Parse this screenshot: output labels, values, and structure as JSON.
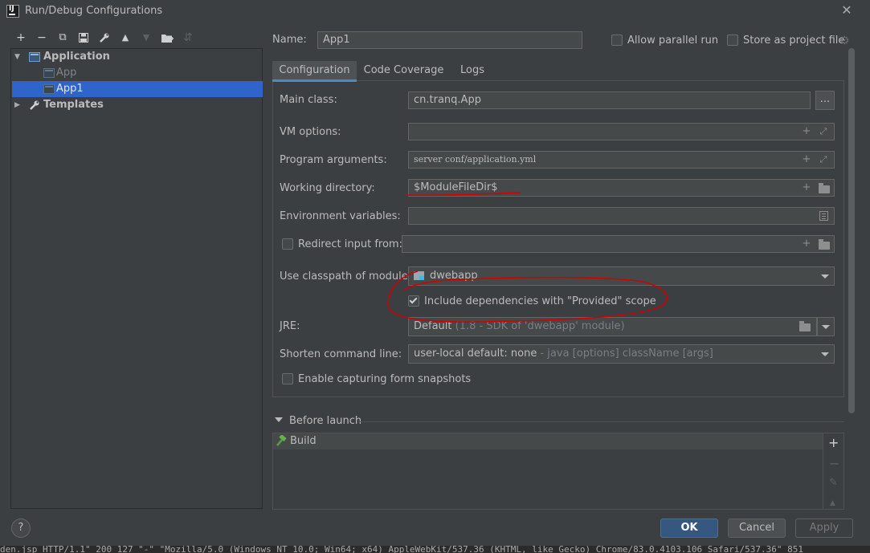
{
  "window": {
    "title": "Run/Debug Configurations",
    "logo_text": "IJ"
  },
  "toolbar": {
    "add": "+",
    "remove": "−",
    "copy": "⧉",
    "save": "▪",
    "edit": "🔧",
    "up": "▲",
    "down": "▼",
    "folder": "▇",
    "sort": "⇵"
  },
  "tree": {
    "application": "Application",
    "app": "App",
    "app1": "App1",
    "templates": "Templates"
  },
  "header": {
    "name_label": "Name:",
    "name_value": "App1",
    "allow_parallel": "Allow parallel run",
    "store_project": "Store as project file"
  },
  "tabs": [
    "Configuration",
    "Code Coverage",
    "Logs"
  ],
  "form": {
    "main_class_label": "Main class:",
    "main_class_value": "cn.tranq.App",
    "browse_label": "...",
    "vm_options_label": "VM options:",
    "vm_options_value": "",
    "program_args_label": "Program arguments:",
    "program_args_value": "server conf/application.yml",
    "working_dir_label": "Working directory:",
    "working_dir_value": "$ModuleFileDir$",
    "env_vars_label": "Environment variables:",
    "env_vars_value": "",
    "redirect_label": "Redirect input from:",
    "redirect_value": "",
    "classpath_label": "Use classpath of module:",
    "classpath_value": "dwebapp",
    "include_provided": "Include dependencies with \"Provided\" scope",
    "jre_label": "JRE:",
    "jre_value": "Default",
    "jre_hint": "(1.8 - SDK of 'dwebapp' module)",
    "shorten_label": "Shorten command line:",
    "shorten_value": "user-local default: none",
    "shorten_hint": "- java [options] className [args]",
    "capture_snapshots": "Enable capturing form snapshots"
  },
  "before_launch": {
    "title": "Before launch",
    "task": "Build"
  },
  "buttons": {
    "help": "?",
    "ok": "OK",
    "cancel": "Cancel",
    "apply": "Apply"
  },
  "console": {
    "text": "den.jsp HTTP/1.1\" 200 127 \"-\" \"Mozilla/5.0 (Windows NT 10.0; Win64; x64) AppleWebKit/537.36 (KHTML, like Gecko) Chrome/83.0.4103.106 Safari/537.36\" 851"
  },
  "colors": {
    "background": "#3c3f41",
    "selection": "#2f65ca",
    "ok_button": "#365880",
    "annotation_red": "#d20000"
  }
}
